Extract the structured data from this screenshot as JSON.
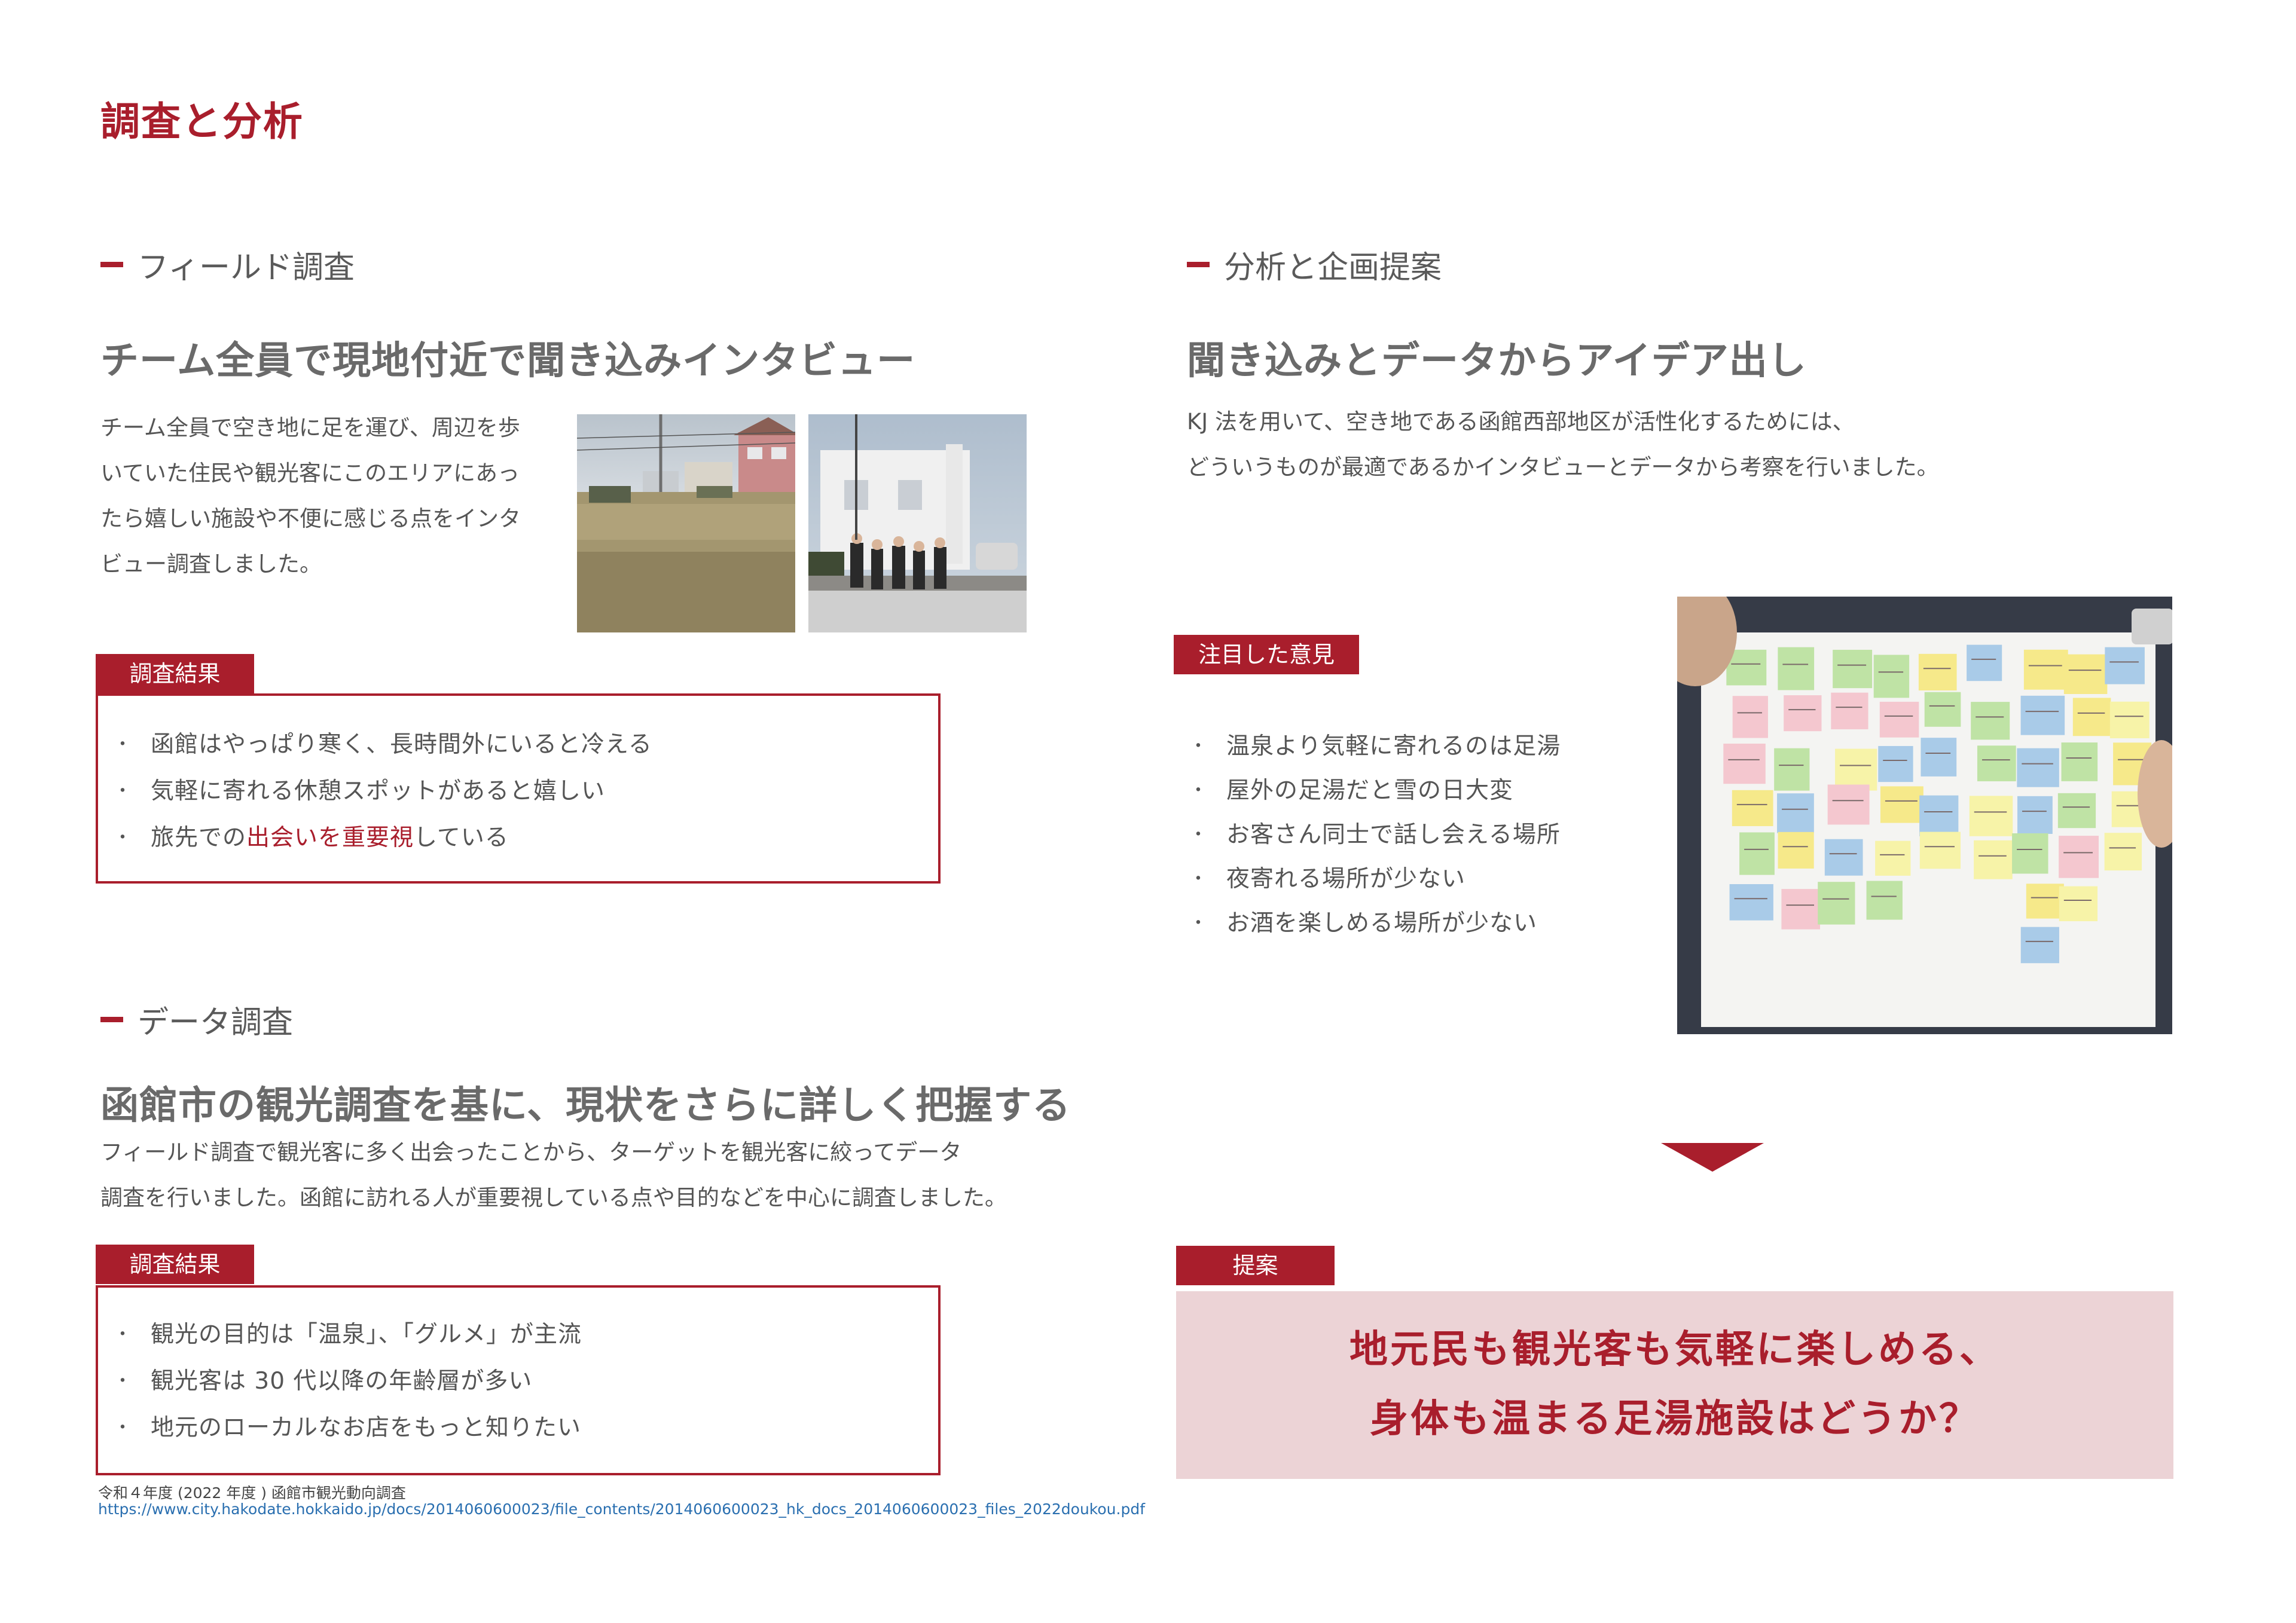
{
  "page_title": "調査と分析",
  "field_survey": {
    "heading": "フィールド調査",
    "lead": "チーム全員で現地付近で聞き込みインタビュー",
    "body": [
      "チーム全員で空き地に足を運び、周辺を歩",
      "いていた住民や観光客にこのエリアにあっ",
      "たら嬉しい施設や不便に感じる点をインタ",
      "ビュー調査しました。"
    ],
    "results_tag": "調査結果",
    "results": [
      {
        "pre": "函館はやっぱり寒く、長時間外にいると冷える",
        "em": "",
        "post": ""
      },
      {
        "pre": "気軽に寄れる休憩スポットがあると嬉しい",
        "em": "",
        "post": ""
      },
      {
        "pre": "旅先での",
        "em": "出会いを重要視",
        "post": "している"
      }
    ]
  },
  "data_survey": {
    "heading": "データ調査",
    "lead": "函館市の観光調査を基に、現状をさらに詳しく把握する",
    "body": [
      "フィールド調査で観光客に多く出会ったことから、ターゲットを観光客に絞ってデータ",
      "調査を行いました。函館に訪れる人が重要視している点や目的などを中心に調査しました。"
    ],
    "results_tag": "調査結果",
    "results": [
      "観光の目的は「温泉」、「グルメ」が主流",
      "観光客は 30 代以降の年齢層が多い",
      "地元のローカルなお店をもっと知りたい"
    ],
    "source_title": "令和４年度 (2022 年度 ) 函館市観光動向調査",
    "source_url": "https://www.city.hakodate.hokkaido.jp/docs/2014060600023/file_contents/2014060600023_hk_docs_2014060600023_files_2022doukou.pdf"
  },
  "analysis": {
    "heading": "分析と企画提案",
    "lead": "聞き込みとデータからアイデア出し",
    "body": [
      "KJ 法を用いて、空き地である函館西部地区が活性化するためには、",
      "どういうものが最適であるかインタビューとデータから考察を行いました。"
    ],
    "opinions_tag": "注目した意見",
    "opinions": [
      "温泉より気軽に寄れるのは足湯",
      "屋外の足湯だと雪の日大変",
      "お客さん同士で話し会える場所",
      "夜寄れる場所が少ない",
      "お酒を楽しめる場所が少ない"
    ],
    "proposal_tag": "提案",
    "proposal": [
      "地元民も観光客も気軽に楽しめる、",
      "身体も温まる足湯施設はどうか？"
    ]
  },
  "colors": {
    "accent": "#a91e2c",
    "proposal_bg": "#ecd3d6",
    "link": "#2a6fb0"
  },
  "icons": {
    "section_marker": "red-dash",
    "flow_arrow": "down-triangle"
  }
}
